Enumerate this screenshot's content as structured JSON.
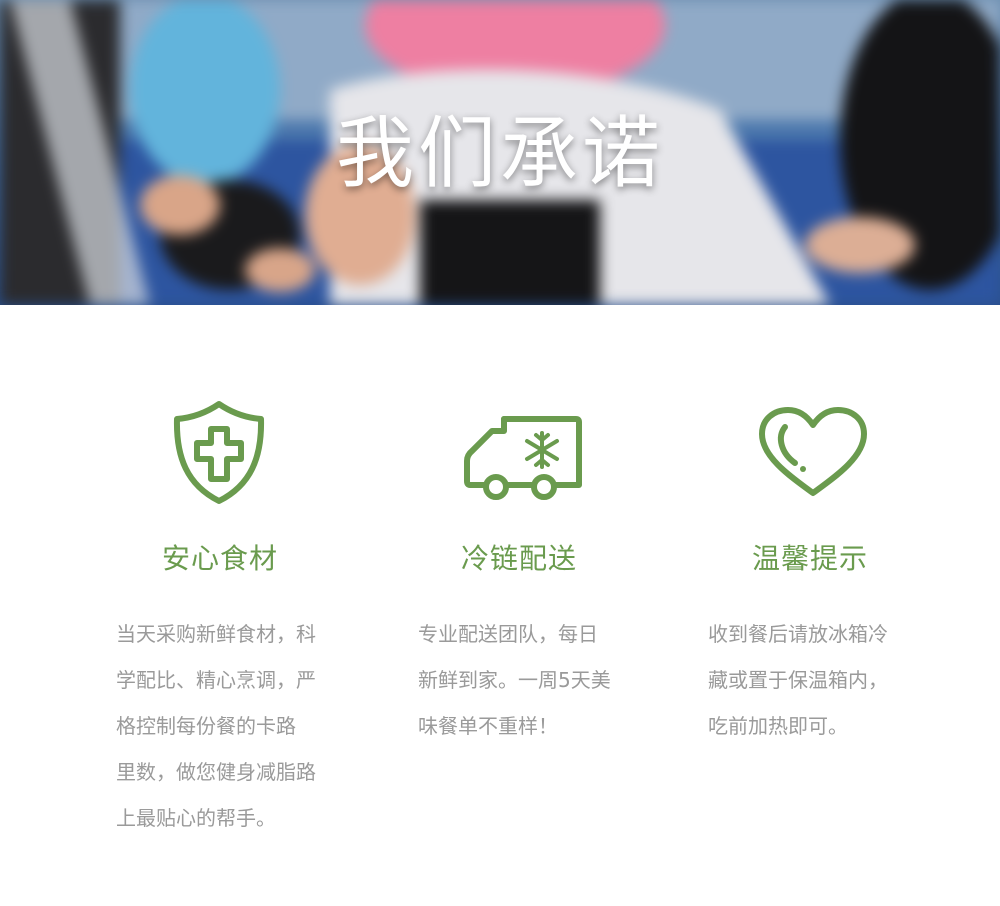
{
  "hero": {
    "title": "我们承诺"
  },
  "features": [
    {
      "icon": "shield-cross-icon",
      "title": "安心食材",
      "lines": [
        "当天采购新鲜食材，科",
        "学配比、精心烹调，严",
        "格控制每份餐的卡路",
        "里数，做您健身减脂路",
        "上最贴心的帮手。"
      ]
    },
    {
      "icon": "refrigerated-truck-icon",
      "title": "冷链配送",
      "lines": [
        "专业配送团队，每日",
        "新鲜到家。一周5天美",
        "味餐单不重样！"
      ]
    },
    {
      "icon": "heart-icon",
      "title": "温馨提示",
      "lines": [
        "收到餐后请放冰箱冷",
        "藏或置于保温箱内，",
        "吃前加热即可。"
      ]
    }
  ],
  "colors": {
    "accent": "#6a9b4e",
    "body_text": "#9a9a9a",
    "hero_text": "#ffffff"
  }
}
